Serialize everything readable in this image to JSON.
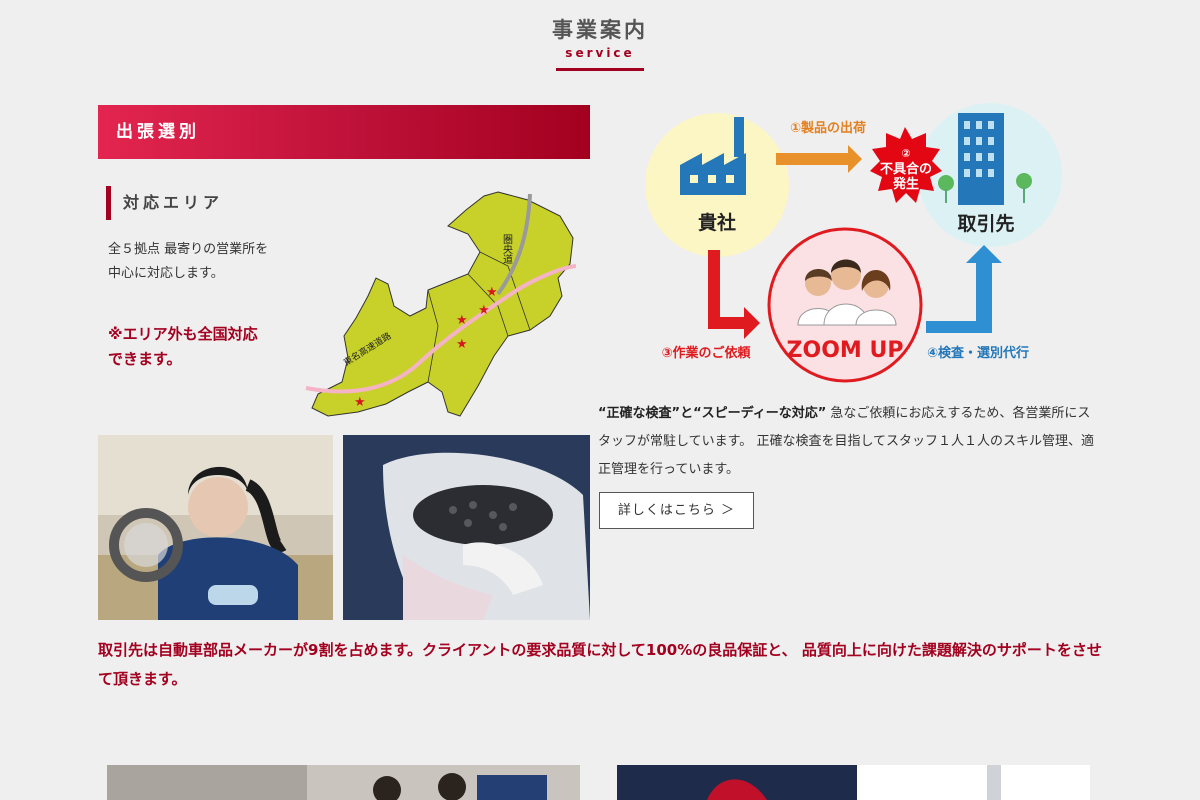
{
  "heading": {
    "jp": "事業案内",
    "en": "service"
  },
  "banner": {
    "title": "出張選別"
  },
  "area": {
    "label": "対応エリア",
    "desc_line1": "全５拠点 最寄りの営業所を",
    "desc_line2": "中心に対応します。",
    "note_line1": "※エリア外も全国対応",
    "note_line2": "できます。"
  },
  "map": {
    "road_label": "東名高速道路",
    "ken_label": "圏央道",
    "colors": {
      "land": "#c8d12a",
      "road": "#f5b3c6",
      "star": "#d4181f"
    }
  },
  "flow": {
    "company": "貴社",
    "client": "取引先",
    "step1": "①製品の出荷",
    "step2_num": "②",
    "step2_line1": "不具合の",
    "step2_line2": "発生",
    "step3": "③作業のご依頼",
    "step4": "④検査・選別代行",
    "zoom": "ZOOM UP"
  },
  "desc": {
    "bold": "“正確な検査”と“スピーディーな対応”",
    "text": " 急なご依頼にお応えするため、各営業所にスタッフが常駐しています。 正確な検査を目指してスタッフ１人１人のスキル管理、適正管理を行っています。"
  },
  "more_button": "詳しくはこちら ＞",
  "statement": "取引先は自動車部品メーカーが9割を占めます。クライアントの要求品質に対して100%の良品保証と、 品質向上に向けた課題解決のサポートをさせて頂きます。"
}
